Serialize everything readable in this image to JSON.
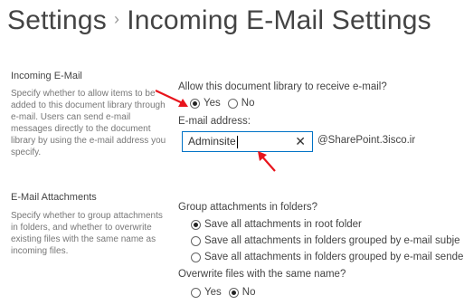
{
  "header": {
    "breadcrumb_root": "Settings",
    "separator": "›",
    "title": "Incoming E-Mail Settings"
  },
  "incoming": {
    "heading": "Incoming E-Mail",
    "description": "Specify whether to allow items to be added to this document library through e-mail. Users can send e-mail messages directly to the document library by using the e-mail address you specify.",
    "question": "Allow this document library to receive e-mail?",
    "options": [
      "Yes",
      "No"
    ],
    "selected": "Yes",
    "address_label": "E-mail address:",
    "address_value": "Adminsite",
    "clear_glyph": "✕",
    "address_domain": "@SharePoint.3isco.ir"
  },
  "attachments": {
    "heading": "E-Mail Attachments",
    "description": "Specify whether to group attachments in folders, and whether to overwrite existing files with the same name as incoming files.",
    "group_question": "Group attachments in folders?",
    "group_options": [
      "Save all attachments in root folder",
      "Save all attachments in folders grouped by e-mail subje",
      "Save all attachments in folders grouped by e-mail sende"
    ],
    "group_selected_index": 0,
    "overwrite_question": "Overwrite files with the same name?",
    "overwrite_options": [
      "Yes",
      "No"
    ],
    "overwrite_selected": "No"
  },
  "colors": {
    "annotation_arrow": "#e8141c",
    "input_border": "#0072c6"
  },
  "icons": [
    "red-arrow-icon",
    "clear-x-icon"
  ]
}
